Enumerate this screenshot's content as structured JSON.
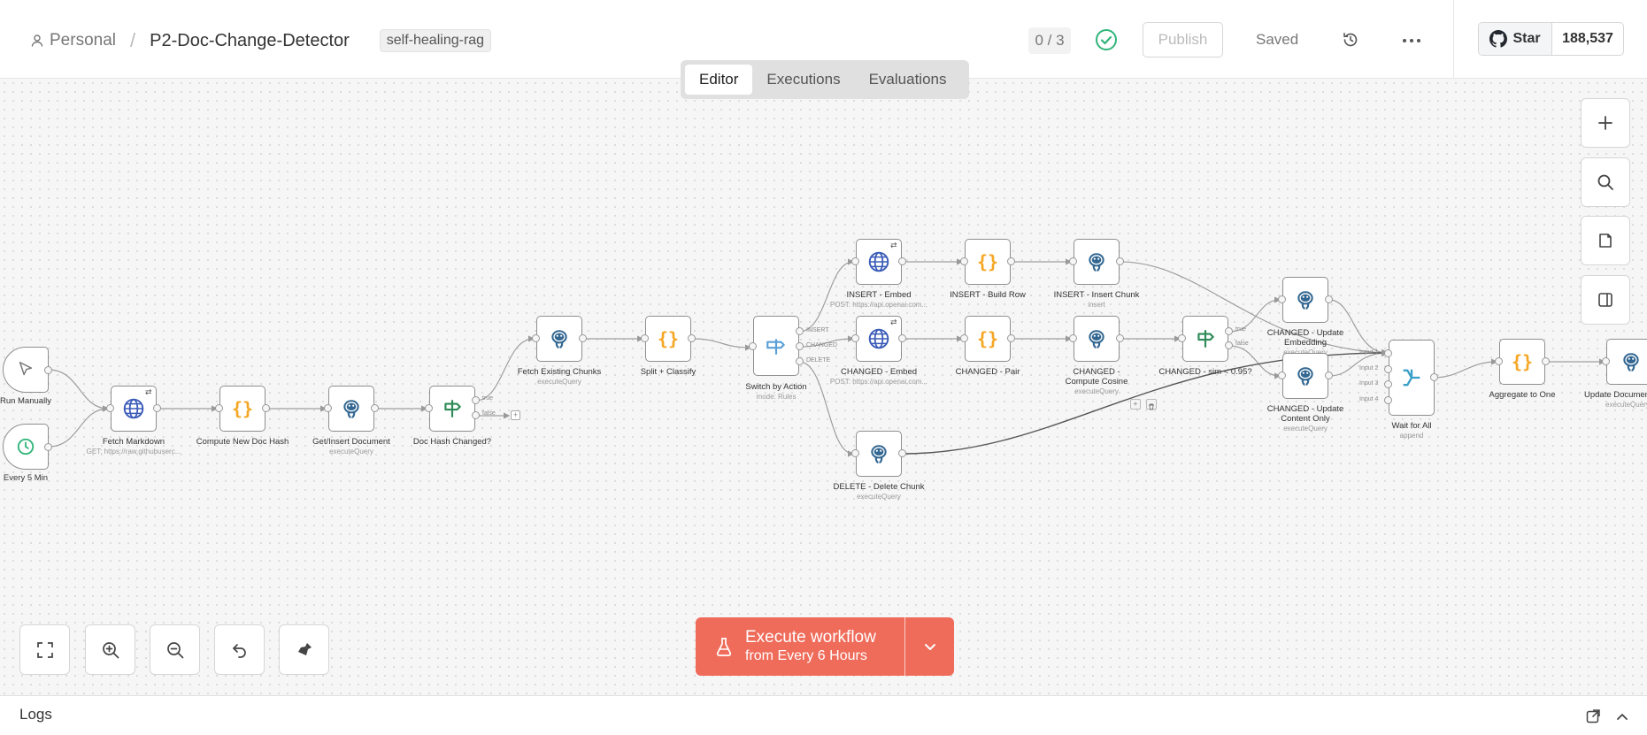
{
  "header": {
    "breadcrumb_owner": "Personal",
    "workflow_name": "P2-Doc-Change-Detector",
    "tag": "self-healing-rag",
    "counter": "0 / 3",
    "publish_label": "Publish",
    "saved_label": "Saved",
    "github_star_label": "Star",
    "github_star_count": "188,537"
  },
  "tabs": [
    {
      "label": "Editor",
      "active": true
    },
    {
      "label": "Executions",
      "active": false
    },
    {
      "label": "Evaluations",
      "active": false
    }
  ],
  "nodes": {
    "run_manually": {
      "label": "Run Manually",
      "icon": "cursor-icon"
    },
    "every_5_min": {
      "label": "Every 5 Min",
      "icon": "clock-icon"
    },
    "fetch_markdown": {
      "label": "Fetch Markdown",
      "sub": "GET: https://raw.githubuserc...",
      "icon": "globe-icon"
    },
    "compute_hash": {
      "label": "Compute New Doc Hash",
      "icon": "code-icon"
    },
    "get_insert_doc": {
      "label": "Get/Insert Document",
      "sub": "executeQuery",
      "icon": "postgres-icon"
    },
    "doc_hash_changed": {
      "label": "Doc Hash Changed?",
      "icon": "if-icon",
      "outputs": [
        "true",
        "false"
      ]
    },
    "fetch_chunks": {
      "label": "Fetch Existing Chunks",
      "sub": "executeQuery",
      "icon": "postgres-icon"
    },
    "split_classify": {
      "label": "Split + Classify",
      "icon": "code-icon"
    },
    "switch_action": {
      "label": "Switch by Action",
      "sub": "mode: Rules",
      "icon": "switch-icon",
      "outputs": [
        "INSERT",
        "CHANGED",
        "DELETE"
      ]
    },
    "insert_embed": {
      "label": "INSERT - Embed",
      "sub": "POST: https://api.openai.com...",
      "icon": "globe-icon"
    },
    "insert_build_row": {
      "label": "INSERT - Build Row",
      "icon": "code-icon"
    },
    "insert_chunk": {
      "label": "INSERT - Insert Chunk",
      "sub": "insert",
      "icon": "postgres-icon"
    },
    "changed_embed": {
      "label": "CHANGED - Embed",
      "sub": "POST: https://api.openai.com...",
      "icon": "globe-icon"
    },
    "changed_pair": {
      "label": "CHANGED - Pair",
      "icon": "code-icon"
    },
    "changed_cosine": {
      "label": "CHANGED - Compute Cosine",
      "sub": "executeQuery",
      "icon": "postgres-icon"
    },
    "changed_sim": {
      "label": "CHANGED - sim < 0.95?",
      "icon": "if-icon",
      "outputs": [
        "true",
        "false"
      ]
    },
    "changed_update_embedding": {
      "label": "CHANGED - Update Embedding",
      "sub": "executeQuery",
      "icon": "postgres-icon"
    },
    "changed_update_content": {
      "label": "CHANGED - Update Content Only",
      "sub": "executeQuery",
      "icon": "postgres-icon"
    },
    "delete_chunk": {
      "label": "DELETE - Delete Chunk",
      "sub": "executeQuery",
      "icon": "postgres-icon"
    },
    "wait_for_all": {
      "label": "Wait for All",
      "sub": "append",
      "icon": "merge-icon",
      "inputs": [
        "Input 1",
        "Input 2",
        "Input 3",
        "Input 4"
      ]
    },
    "aggregate_one": {
      "label": "Aggregate to One",
      "icon": "code-icon"
    },
    "update_document": {
      "label": "Update Document",
      "sub": "executeQuery",
      "icon": "postgres-icon"
    }
  },
  "execute": {
    "line1": "Execute workflow",
    "line2": "from Every 6 Hours"
  },
  "logs": {
    "title": "Logs"
  },
  "colors": {
    "execute": "#ef6b5a",
    "code": "#f5a623",
    "globe": "#3a5bb8",
    "if": "#2e8b57",
    "switch": "#5aa0d8",
    "postgres": "#336791",
    "success": "#2fb579"
  }
}
